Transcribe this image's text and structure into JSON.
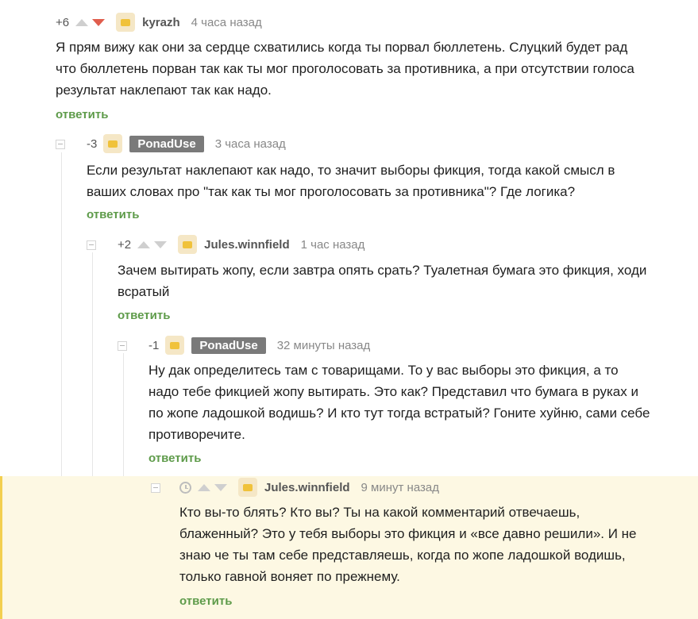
{
  "comments": [
    {
      "rating": "+6",
      "username": "kyrazh",
      "time": "4 часа назад",
      "lines": [
        "Я прям вижу как они за сердце схватились когда ты порвал бюллетень. Слуцкий будет рад",
        "что бюллетень порван так как ты мог проголосовать за противника, а при отсутствии голоса",
        "результат наклепают так как надо."
      ],
      "reply": "ответить"
    },
    {
      "rating": "-3",
      "username": "PonadUse",
      "time": "3 часа назад",
      "lines": [
        "Если результат наклепают как надо, то значит выборы фикция, тогда какой смысл в",
        "ваших словах про \"так как ты мог проголосовать за противника\"? Где логика?"
      ],
      "reply": "ответить"
    },
    {
      "rating": "+2",
      "username": "Jules.winnfield",
      "time": "1 час назад",
      "lines": [
        "Зачем вытирать жопу, если завтра опять срать? Туалетная бумага это фикция, ходи",
        "всратый"
      ],
      "reply": "ответить"
    },
    {
      "rating": "-1",
      "username": "PonadUse",
      "time": "32 минуты назад",
      "lines": [
        "Ну дак определитесь там с товарищами. То у вас выборы это фикция, а то",
        "надо тебе фикцией жопу вытирать. Это как? Представил что бумага в руках и",
        "по жопе ладошкой водишь? И кто тут тогда встратый? Гоните хуйню, сами себе",
        "противоречите."
      ],
      "reply": "ответить"
    },
    {
      "rating": "",
      "username": "Jules.winnfield",
      "time": "9 минут назад",
      "lines": [
        "Кто вы-то блять? Кто вы? Ты на какой комментарий отвечаешь,",
        "блаженный? Это у тебя выборы это фикция и «все давно решили». И не",
        "знаю че ты там себе представляешь, когда по жопе ладошкой водишь,",
        "только гавной воняет по прежнему."
      ],
      "reply": "ответить"
    }
  ],
  "colors": {
    "reply_link": "#5e9b4a",
    "downvote_active": "#e05d4d",
    "highlight_bg": "#fdf8e3",
    "highlight_border": "#f3cf4f",
    "op_badge_bg": "#7a7a7a"
  },
  "icons": [
    "collapse-icon",
    "upvote-arrow-icon",
    "downvote-arrow-icon",
    "avatar-icon",
    "clock-icon"
  ]
}
